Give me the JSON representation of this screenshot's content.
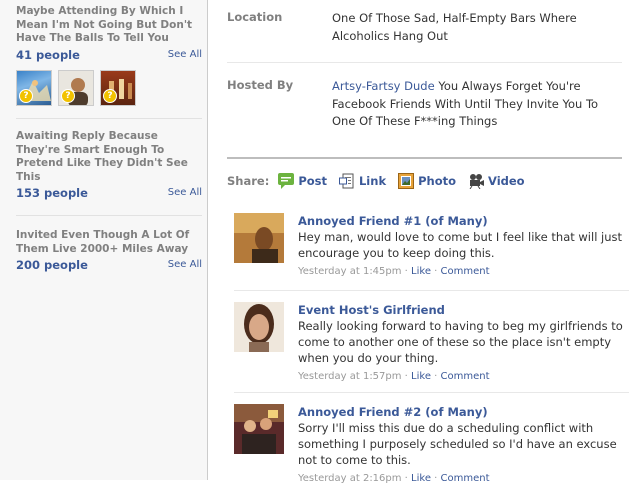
{
  "sidebar": {
    "maybe": {
      "heading": "Maybe Attending By Which I Mean I'm Not Going But Don't Have The Balls To Tell You",
      "count": "41 people",
      "see_all": "See All"
    },
    "awaiting": {
      "heading": "Awaiting Reply Because They're Smart Enough To Pretend Like They Didn't See This",
      "count": "153 people",
      "see_all": "See All"
    },
    "invited": {
      "heading": "Invited Even Though A Lot Of Them Live 2000+ Miles Away",
      "count": "200 people",
      "see_all": "See All"
    }
  },
  "event": {
    "location_label": "Location",
    "location_value": "One Of Those Sad, Half-Empty Bars Where Alcoholics Hang Out",
    "hosted_label": "Hosted By",
    "host_name": "Artsy-Fartsy Dude",
    "host_desc": " You Always Forget You're Facebook Friends With Until They Invite You To One Of These F***ing Things"
  },
  "share": {
    "label": "Share:",
    "items": [
      "Post",
      "Link",
      "Photo",
      "Video"
    ]
  },
  "posts": [
    {
      "author": "Annoyed Friend #1 (of Many)",
      "text": "Hey man, would love to come but I feel like that will just encourage you to keep doing this.",
      "time": "Yesterday at 1:45pm",
      "like": "Like",
      "comment": "Comment"
    },
    {
      "author": "Event Host's Girlfriend",
      "text": "Really looking forward to having to beg my girlfriends to come to another one of these so the place isn't empty when you do your thing.",
      "time": "Yesterday at 1:57pm",
      "like": "Like",
      "comment": "Comment"
    },
    {
      "author": "Annoyed Friend #2 (of Many)",
      "text": "Sorry I'll miss this due do a scheduling conflict with something I purposely scheduled so I'd have an excuse not to come to this.",
      "time": "Yesterday at 2:16pm",
      "like": "Like",
      "comment": "Comment"
    }
  ],
  "colors": {
    "link": "#3b5998",
    "label_gray": "#808080",
    "sidebar_bg": "#f7f7f7",
    "meta_gray": "#999999"
  }
}
